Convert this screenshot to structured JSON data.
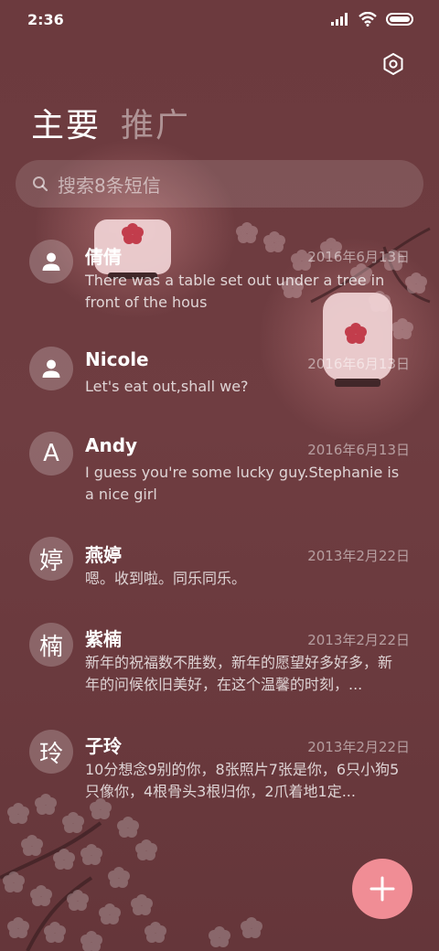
{
  "status_bar": {
    "time": "2:36",
    "icons": [
      "signal-icon",
      "wifi-icon",
      "battery-icon"
    ]
  },
  "header": {
    "settings_icon": "gear-icon"
  },
  "tabs": [
    {
      "label": "主要",
      "active": true
    },
    {
      "label": "推广",
      "active": false
    }
  ],
  "search": {
    "placeholder": "搜索8条短信",
    "icon": "search-icon"
  },
  "conversations": [
    {
      "name": "倩倩",
      "avatar": "",
      "date": "2016年6月13日",
      "snippet": "There was a table set out under a tree in front of the hous"
    },
    {
      "name": "Nicole",
      "avatar": "",
      "date": "2016年6月13日",
      "snippet": "Let's eat out,shall we?"
    },
    {
      "name": "Andy",
      "avatar": "A",
      "date": "2016年6月13日",
      "snippet": "I guess you're some lucky guy.Stephanie is a nice girl"
    },
    {
      "name": "燕婷",
      "avatar": "婷",
      "date": "2013年2月22日",
      "snippet": "嗯。收到啦。同乐同乐。"
    },
    {
      "name": "紫楠",
      "avatar": "楠",
      "date": "2013年2月22日",
      "snippet": "新年的祝福数不胜数，新年的愿望好多好多，新年的问候依旧美好，在这个温馨的时刻，..."
    },
    {
      "name": "子玲",
      "avatar": "玲",
      "date": "2013年2月22日",
      "snippet": "10分想念9别的你，8张照片7张是你，6只小狗5只像你，4根骨头3根归你，2爪着地1定..."
    }
  ],
  "fab": {
    "icon": "plus-icon"
  },
  "colors": {
    "background": "#6e3d41",
    "fab": "#f08d95"
  }
}
